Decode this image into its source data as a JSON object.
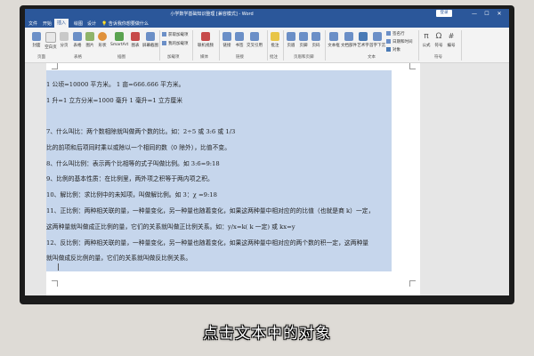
{
  "window": {
    "title": "小学数学基础知识整理 [兼容模式] - Word",
    "signin_label": "登录",
    "controls": [
      "—",
      "☐",
      "✕"
    ]
  },
  "menu": {
    "tabs": [
      "文件",
      "开始",
      "插入",
      "绘图",
      "设计",
      "布局",
      "引用",
      "邮件",
      "审阅",
      "视图",
      "帮助"
    ],
    "active_index": 2,
    "tell_me": "告诉我你想要做什么"
  },
  "ribbon": {
    "buttons": [
      {
        "label": "封面",
        "icon": "cover-icon",
        "color": "#6b8fc7"
      },
      {
        "label": "空白页",
        "icon": "blank-page-icon",
        "color": "#e8e8e8"
      },
      {
        "label": "分页",
        "icon": "page-break-icon",
        "color": "#c9c9c9"
      },
      {
        "label": "表格",
        "icon": "table-icon",
        "color": "#6b8fc7"
      },
      {
        "label": "图片",
        "icon": "picture-icon",
        "color": "#8fb46a"
      },
      {
        "label": "形状",
        "icon": "shapes-icon",
        "color": "#e0913a"
      },
      {
        "label": "SmartArt",
        "icon": "smartart-icon",
        "color": "#5aa350"
      },
      {
        "label": "图表",
        "icon": "chart-icon",
        "color": "#c74b4b"
      },
      {
        "label": "屏幕截图",
        "icon": "screenshot-icon",
        "color": "#6b8fc7"
      },
      {
        "label": "联机视频",
        "icon": "video-icon",
        "color": "#c74b4b"
      },
      {
        "label": "链接",
        "icon": "link-icon",
        "color": "#6b8fc7"
      },
      {
        "label": "书签",
        "icon": "bookmark-icon",
        "color": "#6b8fc7"
      },
      {
        "label": "交叉引用",
        "icon": "cross-ref-icon",
        "color": "#6b8fc7"
      },
      {
        "label": "批注",
        "icon": "comment-icon",
        "color": "#e8c547"
      },
      {
        "label": "页眉",
        "icon": "header-icon",
        "color": "#6b8fc7"
      },
      {
        "label": "页脚",
        "icon": "footer-icon",
        "color": "#6b8fc7"
      },
      {
        "label": "页码",
        "icon": "page-number-icon",
        "color": "#6b8fc7"
      },
      {
        "label": "文本框",
        "icon": "textbox-icon",
        "color": "#6b8fc7"
      },
      {
        "label": "文档部件",
        "icon": "quick-parts-icon",
        "color": "#6b8fc7"
      },
      {
        "label": "艺术字",
        "icon": "wordart-icon",
        "color": "#4a7ab5"
      },
      {
        "label": "首字下沉",
        "icon": "dropcap-icon",
        "color": "#6b8fc7"
      },
      {
        "label": "公式",
        "icon": "equation-icon",
        "color": "#555555"
      },
      {
        "label": "符号",
        "icon": "symbol-icon",
        "color": "#555555"
      },
      {
        "label": "编号",
        "icon": "number-icon",
        "color": "#555555"
      }
    ],
    "small_items": [
      "获取加载项",
      "我的加载项",
      "签名行",
      "日期和时间",
      "对象"
    ],
    "groups": [
      "页面",
      "表格",
      "插图",
      "加载项",
      "媒体",
      "链接",
      "批注",
      "页眉和页脚",
      "文本",
      "符号"
    ]
  },
  "document": {
    "lines": [
      "1 公顷=10000 平方米。 1 亩=666.666 平方米。",
      "1 升=1 立方分米=1000 毫升 1 毫升=1 立方厘米",
      "7、什么叫比：两个数相除就叫做两个数的比。如：2÷5 或 3:6 或 1/3",
      "比的前项和后项同时乘以或除以一个相同的数（0 除外），比值不变。",
      "8、什么叫比例：表示两个比相等的式子叫做比例。如 3:6=9:18",
      "9、比例的基本性质：在比例里，两外项之积等于两内项之积。",
      "10、解比例：求比例中的未知项，叫做解比例。如 3：χ =9:18",
      "11、正比例：两种相关联的量，一种量变化，另一种量也随着变化，如果这两种量中相对应的的比值（也就是商 k）一定，",
      "这两种量就叫做成正比例的量，它们的关系就叫做正比例关系。如：y/x=k( k 一定) 或 kx=y",
      "12、反比例：两种相关联的量，一种量变化，另一种量也随着变化，如果这两种量中相对应的两个数的积一定，这两种量",
      "就叫做成反比例的量，它们的关系就叫做反比例关系。"
    ]
  },
  "subtitle": "点击文本中的对象",
  "colors": {
    "word_blue": "#2b579a",
    "selection": "#c6d6ec"
  }
}
